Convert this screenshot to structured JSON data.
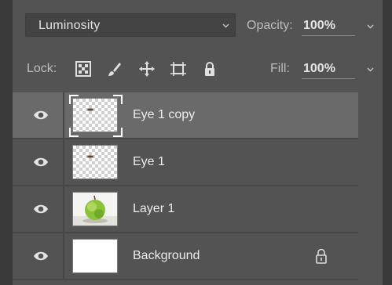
{
  "blend_mode": {
    "value": "Luminosity"
  },
  "opacity": {
    "label": "Opacity:",
    "value": "100%"
  },
  "lock": {
    "label": "Lock:",
    "icons": [
      "lock-transparent-pixels-icon",
      "lock-image-pixels-icon",
      "lock-position-icon",
      "lock-artboard-icon",
      "lock-all-icon"
    ]
  },
  "fill": {
    "label": "Fill:",
    "value": "100%"
  },
  "layers": [
    {
      "name": "Eye 1 copy",
      "thumbnail": "transparent-with-eye",
      "visible": true,
      "selected": true,
      "locked": false
    },
    {
      "name": "Eye 1",
      "thumbnail": "transparent-with-eye",
      "visible": true,
      "selected": false,
      "locked": false
    },
    {
      "name": "Layer 1",
      "thumbnail": "green-apple",
      "visible": true,
      "selected": false,
      "locked": false
    },
    {
      "name": "Background",
      "thumbnail": "white",
      "visible": true,
      "selected": false,
      "locked": true
    }
  ],
  "colors": {
    "panel": "#535353",
    "selected_row": "#6a6a6a",
    "text": "#ececec"
  }
}
